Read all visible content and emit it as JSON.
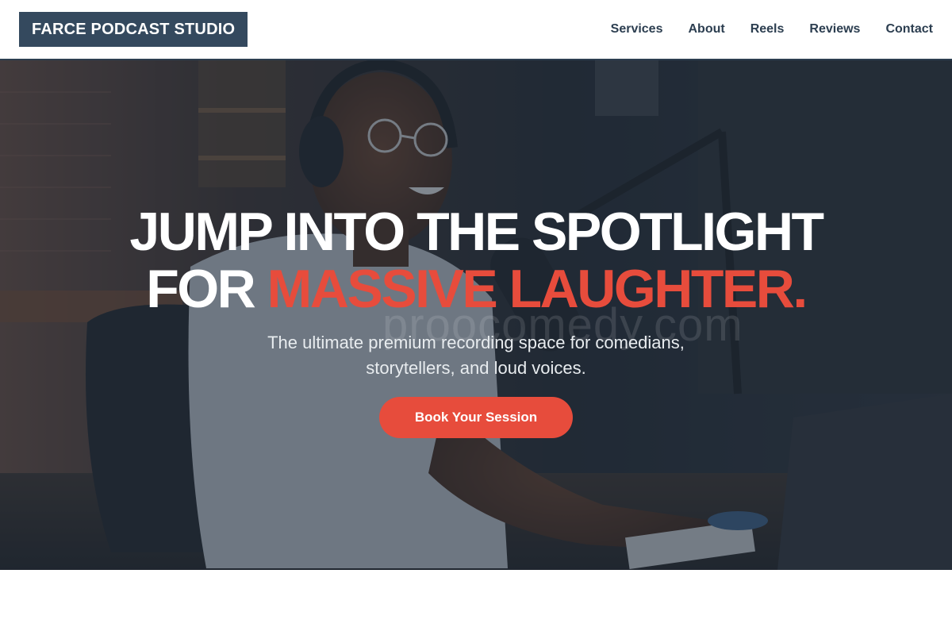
{
  "header": {
    "logo_text": "FARCE PODCAST STUDIO",
    "nav": [
      {
        "label": "Services"
      },
      {
        "label": "About"
      },
      {
        "label": "Reels"
      },
      {
        "label": "Reviews"
      },
      {
        "label": "Contact"
      }
    ]
  },
  "hero": {
    "headline_line1": "JUMP INTO THE SPOTLIGHT",
    "headline_line2_prefix": "FOR ",
    "headline_line2_accent": "MASSIVE LAUGHTER.",
    "subtitle_line1": "The ultimate premium recording space for comedians,",
    "subtitle_line2": "storytellers, and loud voices.",
    "cta_label": "Book Your Session",
    "watermark": "proocomedy.com"
  },
  "colors": {
    "header_logo_bg": "#34495e",
    "nav_text": "#2c3e50",
    "accent": "#e74c3c",
    "hero_overlay": "#232f3e"
  }
}
